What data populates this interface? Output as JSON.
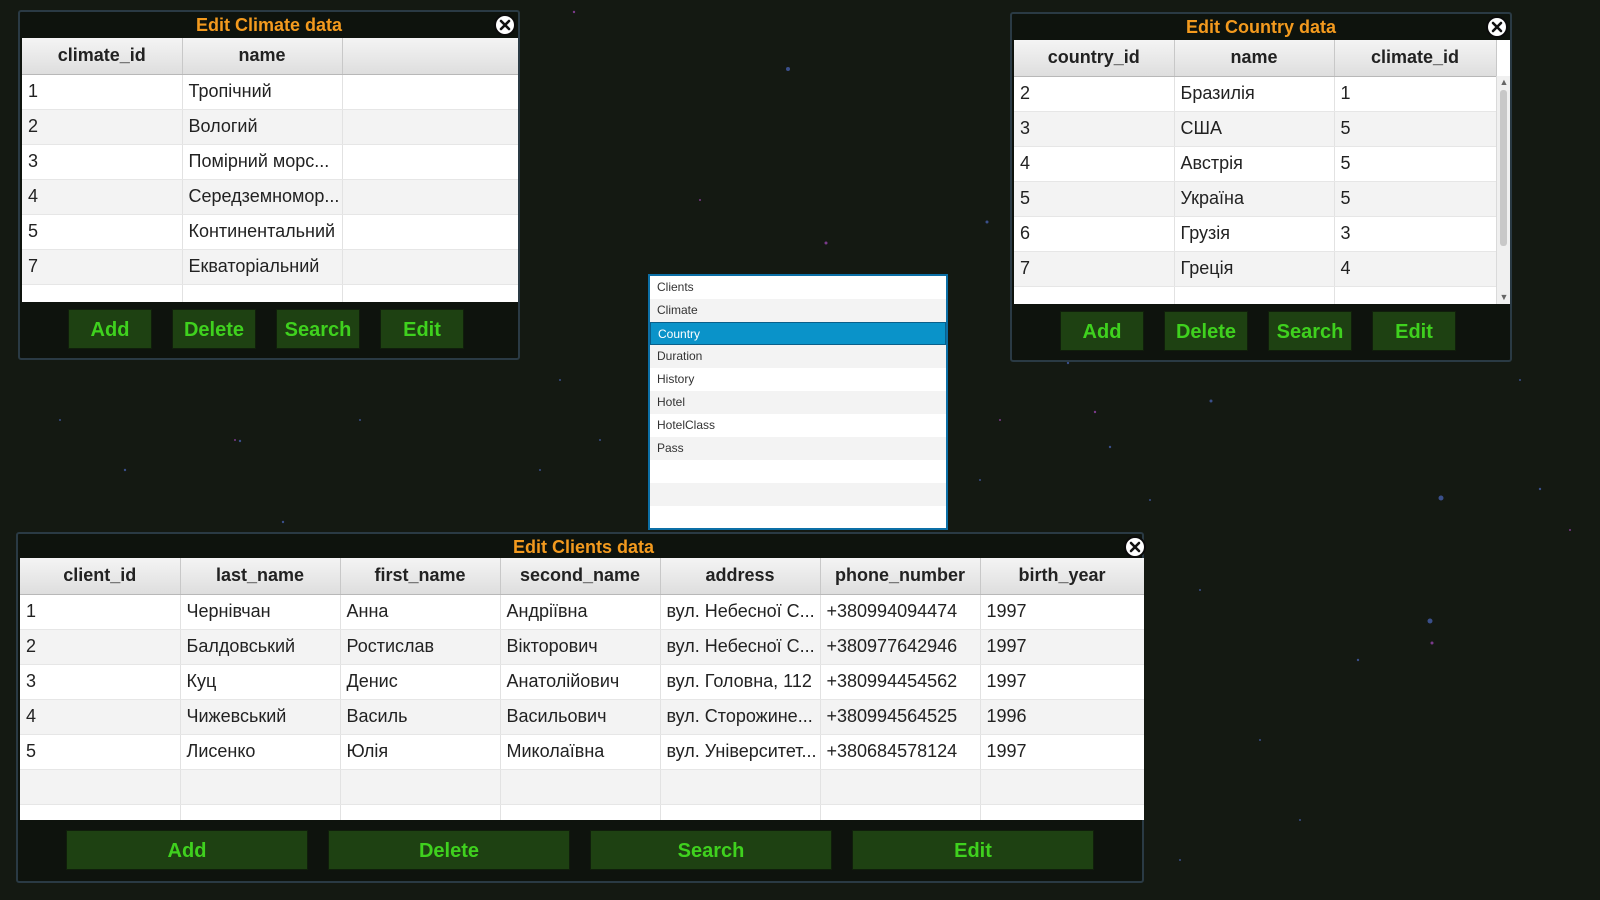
{
  "climate_window": {
    "title": "Edit Climate data",
    "columns": [
      "climate_id",
      "name",
      ""
    ],
    "rows": [
      [
        "1",
        "Тропічний",
        ""
      ],
      [
        "2",
        "Вологий",
        ""
      ],
      [
        "3",
        "Помірний морс...",
        ""
      ],
      [
        "4",
        "Середземномор...",
        ""
      ],
      [
        "5",
        "Континентальний",
        ""
      ],
      [
        "7",
        "Екваторіальний",
        ""
      ]
    ],
    "buttons": {
      "add": "Add",
      "delete": "Delete",
      "search": "Search",
      "edit": "Edit"
    }
  },
  "country_window": {
    "title": "Edit Country data",
    "columns": [
      "country_id",
      "name",
      "climate_id"
    ],
    "rows": [
      [
        "2",
        "Бразилія",
        "1"
      ],
      [
        "3",
        "США",
        "5"
      ],
      [
        "4",
        "Австрія",
        "5"
      ],
      [
        "5",
        "Україна",
        "5"
      ],
      [
        "6",
        "Грузія",
        "3"
      ],
      [
        "7",
        "Греція",
        "4"
      ]
    ],
    "buttons": {
      "add": "Add",
      "delete": "Delete",
      "search": "Search",
      "edit": "Edit"
    }
  },
  "table_list": {
    "items": [
      "Clients",
      "Climate",
      "Country",
      "Duration",
      "History",
      "Hotel",
      "HotelClass",
      "Pass"
    ],
    "selected": "Country"
  },
  "clients_window": {
    "title": "Edit Clients data",
    "columns": [
      "client_id",
      "last_name",
      "first_name",
      "second_name",
      "address",
      "phone_number",
      "birth_year"
    ],
    "rows": [
      [
        "1",
        "Чернівчан",
        "Анна",
        "Андріївна",
        "вул. Небесної С...",
        "+380994094474",
        "1997"
      ],
      [
        "2",
        "Балдовський",
        "Ростислав",
        "Вікторович",
        "вул. Небесної С...",
        "+380977642946",
        "1997"
      ],
      [
        "3",
        "Куц",
        "Денис",
        "Анатолійович",
        "вул. Головна, 112",
        "+380994454562",
        "1997"
      ],
      [
        "4",
        "Чижевський",
        "Василь",
        "Васильович",
        "вул. Сторожине...",
        "+380994564525",
        "1996"
      ],
      [
        "5",
        "Лисенко",
        "Юлія",
        "Миколаївна",
        "вул. Університет...",
        "+380684578124",
        "1997"
      ]
    ],
    "buttons": {
      "add": "Add",
      "delete": "Delete",
      "search": "Search",
      "edit": "Edit"
    }
  },
  "colors": {
    "background": "#141912",
    "title": "#f39a1e",
    "button_bg": "#1e4112",
    "button_text": "#3fd11e",
    "selection": "#0a93c9"
  },
  "icons": {
    "close": "close-circle-icon"
  }
}
